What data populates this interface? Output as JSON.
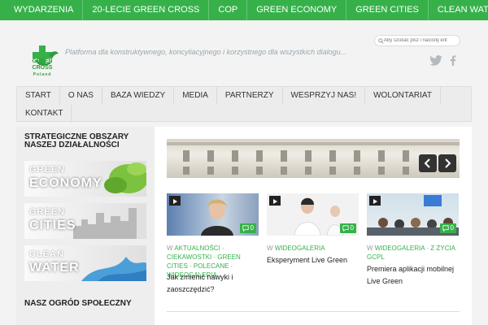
{
  "topnav": [
    "WYDARZENIA",
    "20-LECIE GREEN CROSS",
    "COP",
    "GREEN ECONOMY",
    "GREEN CITIES",
    "CLEAN WATER"
  ],
  "logo": {
    "line1": "GREEN",
    "line2": "CROSS",
    "line3": "Poland"
  },
  "tagline": "Platforma dla konstruktywnego, koncyliacyjnego i korzystnego dla wszystkich dialogu...",
  "search": {
    "placeholder": "Aby szukać pisz i naciśnij ent"
  },
  "mainnav": {
    "row1": [
      "START",
      "O NAS",
      "BAZA WIEDZY",
      "MEDIA",
      "PARTNERZY",
      "WESPRZYJ NAS!",
      "WOLONTARIAT"
    ],
    "row2": [
      "KONTAKT"
    ]
  },
  "sidebar": {
    "title": "STRATEGICZNE OBSZARY NASZEJ DZIAŁALNOŚCI",
    "banners": [
      {
        "w1": "GREEN",
        "w2": "ECONOMY"
      },
      {
        "w1": "GREEN",
        "w2": "CITIES"
      },
      {
        "w1": "CLEAN",
        "w2": "WATER"
      }
    ],
    "subtitle": "NASZ OGRÓD SPOŁECZNY"
  },
  "cards": [
    {
      "comments": "0",
      "meta_prefix": "W",
      "categories": "AKTUALNOŚCI · CIEKAWOSTKI · GREEN CITIES · POLECANE · WIDEOGALERIA",
      "title": "Jak zmienić nawyki i zaoszczędzić?"
    },
    {
      "comments": "0",
      "meta_prefix": "W",
      "categories": "WIDEOGALERIA",
      "title": "Eksperyment Live Green"
    },
    {
      "comments": "0",
      "meta_prefix": "W",
      "categories": "WIDEOGALERIA · Z ŻYCIA GCPL",
      "title": "Premiera aplikacji mobilnej Live Green"
    }
  ],
  "colors": {
    "brand_green": "#36b14a",
    "dark_green": "#2e9c3d"
  }
}
